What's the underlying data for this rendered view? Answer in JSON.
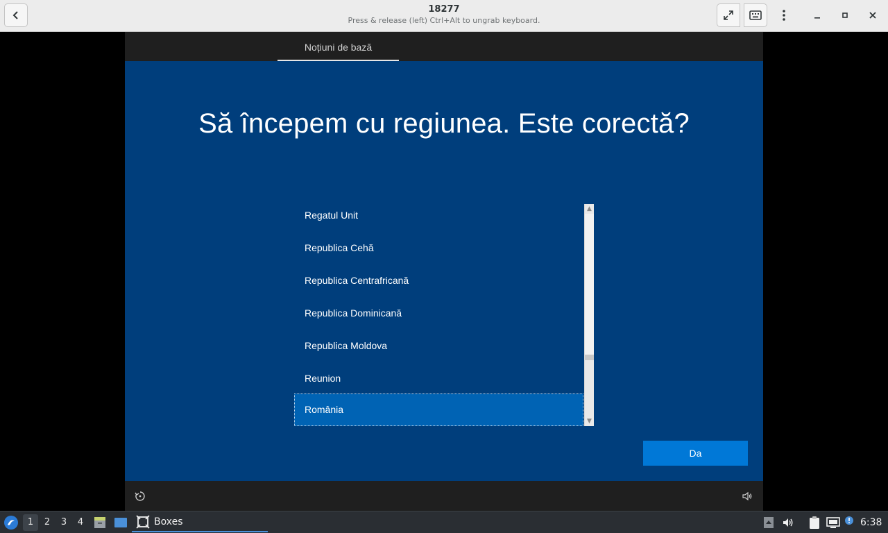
{
  "window": {
    "title": "18277",
    "subtitle": "Press & release (left) Ctrl+Alt to ungrab keyboard."
  },
  "guest": {
    "tab_label": "Noțiuni de bază",
    "heading": "Să începem cu regiunea. Este corectă?",
    "regions": [
      {
        "label": "Regatul Unit"
      },
      {
        "label": "Republica Cehă"
      },
      {
        "label": "Republica Centrafricană"
      },
      {
        "label": "Republica Dominicană"
      },
      {
        "label": "Republica Moldova"
      },
      {
        "label": "Reunion"
      },
      {
        "label": "România"
      }
    ],
    "selected_region": "România",
    "confirm_label": "Da",
    "accent_color": "#0078d7",
    "background_color": "#003e7c"
  },
  "taskbar": {
    "workspaces": [
      "1",
      "2",
      "3",
      "4"
    ],
    "active_workspace": "1",
    "task_label": "Boxes",
    "clock": "6:38"
  }
}
